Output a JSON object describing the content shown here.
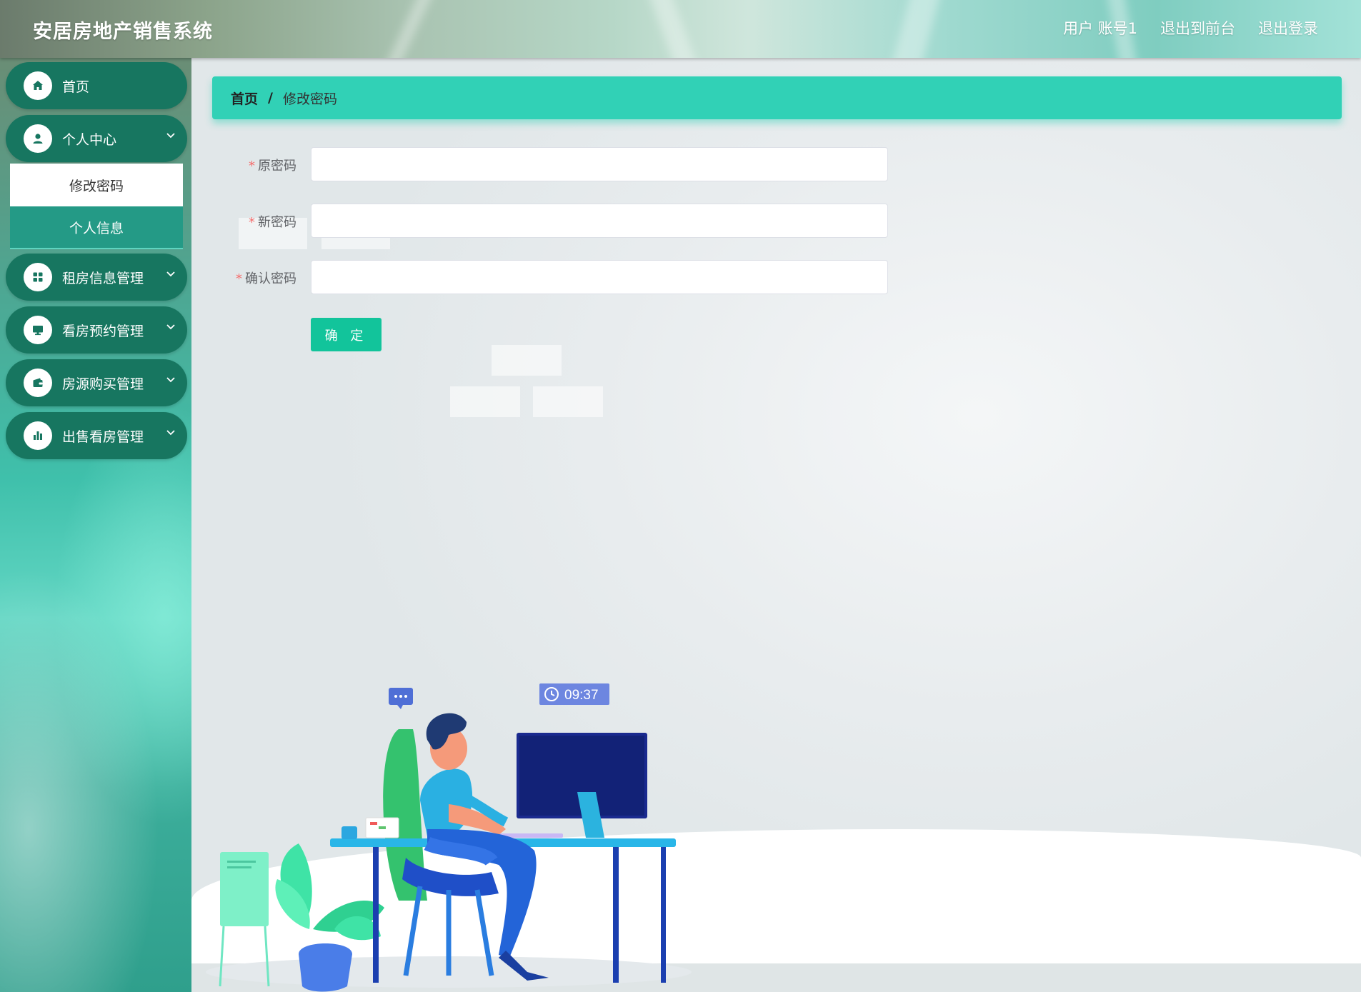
{
  "header": {
    "title": "安居房地产销售系统",
    "user": "用户 账号1",
    "to_front": "退出到前台",
    "logout": "退出登录"
  },
  "sidebar": {
    "items": [
      {
        "label": "首页",
        "icon": "home-icon"
      },
      {
        "label": "个人中心",
        "icon": "user-icon",
        "expanded": true,
        "children": [
          {
            "label": "修改密码",
            "active": true
          },
          {
            "label": "个人信息",
            "active": false
          }
        ]
      },
      {
        "label": "租房信息管理",
        "icon": "grid-icon"
      },
      {
        "label": "看房预约管理",
        "icon": "monitor-icon"
      },
      {
        "label": "房源购买管理",
        "icon": "wallet-icon"
      },
      {
        "label": "出售看房管理",
        "icon": "bar-chart-icon"
      }
    ]
  },
  "breadcrumb": {
    "home": "首页",
    "separator": "/",
    "current": "修改密码"
  },
  "form": {
    "old_password": {
      "label": "原密码",
      "value": "",
      "required_mark": "*"
    },
    "new_password": {
      "label": "新密码",
      "value": "",
      "required_mark": "*"
    },
    "confirm_password": {
      "label": "确认密码",
      "value": "",
      "required_mark": "*"
    },
    "submit": "确 定"
  },
  "illustration": {
    "clock": "09:37",
    "chat_bubble": "..."
  },
  "colors": {
    "sidebar_pill": "#177660",
    "breadcrumb_bg": "#31d1b6",
    "button": "#12c49b",
    "required": "#f56c6c"
  }
}
